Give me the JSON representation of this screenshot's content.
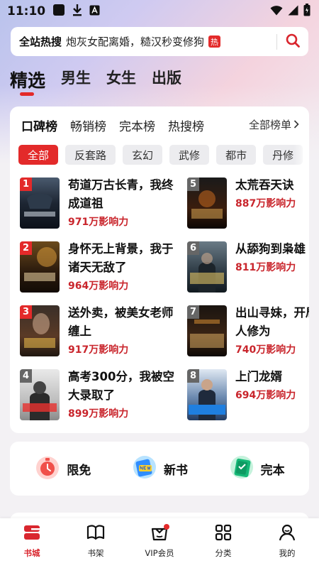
{
  "status_bar": {
    "time": "11:10"
  },
  "search": {
    "hot_label": "全站热搜",
    "hot_query": "炮灰女配离婚，糙汉秒变修狗",
    "hot_badge": "热"
  },
  "channels": [
    {
      "label": "精选",
      "active": true
    },
    {
      "label": "男生",
      "active": false
    },
    {
      "label": "女生",
      "active": false
    },
    {
      "label": "出版",
      "active": false
    }
  ],
  "rank_tabs": [
    {
      "label": "口碑榜",
      "active": true
    },
    {
      "label": "畅销榜",
      "active": false
    },
    {
      "label": "完本榜",
      "active": false
    },
    {
      "label": "热搜榜",
      "active": false
    }
  ],
  "all_ranks_label": "全部榜单",
  "chips": [
    {
      "label": "全部",
      "active": true
    },
    {
      "label": "反套路",
      "active": false
    },
    {
      "label": "玄幻",
      "active": false
    },
    {
      "label": "武修",
      "active": false
    },
    {
      "label": "都市",
      "active": false
    },
    {
      "label": "丹修",
      "active": false
    }
  ],
  "books": [
    {
      "rank": "1",
      "title": "苟道万古长青，我终成道祖",
      "influence": "971万影响力",
      "badge_color": "#e32a2a"
    },
    {
      "rank": "2",
      "title": "身怀无上背景，我于诸天无敌了",
      "influence": "964万影响力",
      "badge_color": "#e32a2a"
    },
    {
      "rank": "3",
      "title": "送外卖，被美女老师缠上",
      "influence": "917万影响力",
      "badge_color": "#e32a2a"
    },
    {
      "rank": "4",
      "title": "高考300分，我被空大录取了",
      "influence": "899万影响力",
      "badge_color": "#666666"
    },
    {
      "rank": "5",
      "title": "太荒吞天诀",
      "influence": "887万影响力",
      "badge_color": "#666666"
    },
    {
      "rank": "6",
      "title": "从舔狗到枭雄",
      "influence": "811万影响力",
      "badge_color": "#666666"
    },
    {
      "rank": "7",
      "title": "出山寻妹，开局光仙人修为",
      "influence": "740万影响力",
      "badge_color": "#666666"
    },
    {
      "rank": "8",
      "title": "上门龙婿",
      "influence": "694万影响力",
      "badge_color": "#666666"
    }
  ],
  "quick_entries": [
    {
      "label": "限免",
      "icon": "stopwatch-icon"
    },
    {
      "label": "新书",
      "icon": "new-book-icon"
    },
    {
      "label": "完本",
      "icon": "finished-book-icon"
    }
  ],
  "nav": [
    {
      "label": "书城",
      "icon": "bookstore-icon",
      "active": true
    },
    {
      "label": "书架",
      "icon": "open-book-icon",
      "active": false
    },
    {
      "label": "VIP会员",
      "icon": "crown-bag-icon",
      "active": false
    },
    {
      "label": "分类",
      "icon": "grid-icon",
      "active": false
    },
    {
      "label": "我的",
      "icon": "person-icon",
      "active": false
    }
  ]
}
